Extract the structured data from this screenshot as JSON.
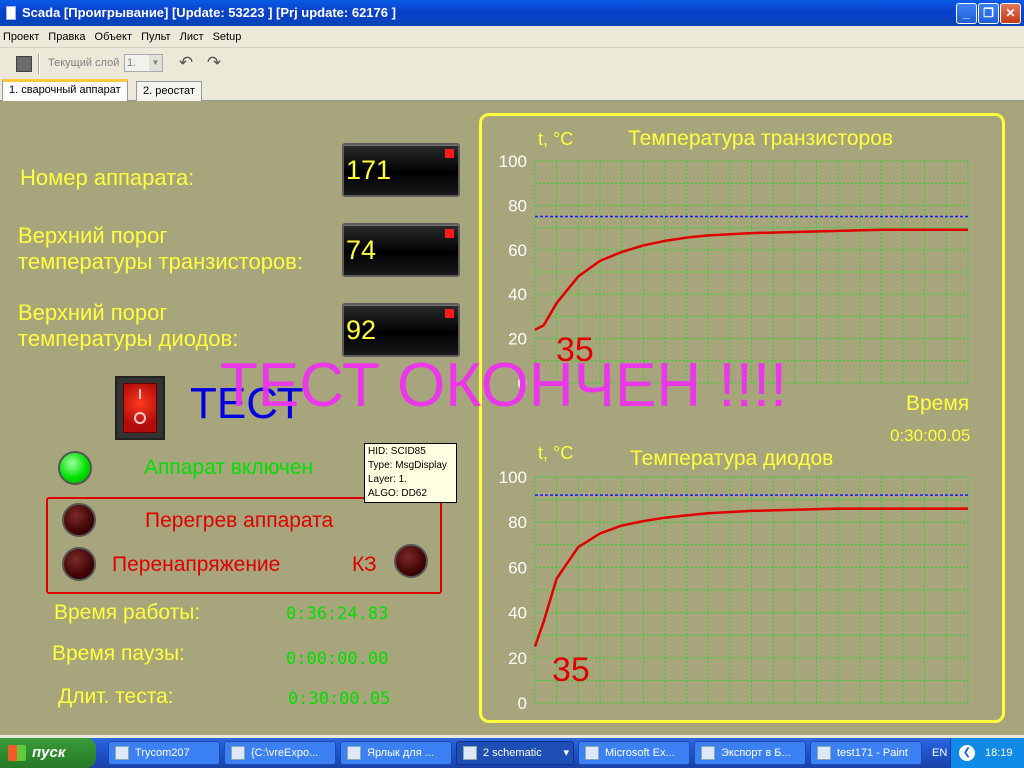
{
  "window": {
    "title": "Scada [Проигрывание] [Update: 53223 ] [Prj update: 62176 ]",
    "min_icon": "_",
    "max_icon": "❐",
    "close_icon": "✕"
  },
  "menu": [
    "Проект",
    "Правка",
    "Объект",
    "Пульт",
    "Лист",
    "Setup"
  ],
  "toolbar": {
    "layer_label": "Текущий слой",
    "layer_value": "1.",
    "undo_icon": "↶",
    "redo_icon": "↷"
  },
  "tabs": [
    "1. сварочный аппарат",
    "2. реостат"
  ],
  "panel": {
    "device_number_label": "Номер аппарата:",
    "device_number": "171",
    "transistor_threshold_label_1": "Верхний порог",
    "transistor_threshold_label_2": "температуры транзисторов:",
    "transistor_threshold": "74",
    "diode_threshold_label_1": "Верхний порог",
    "diode_threshold_label_2": "температуры диодов:",
    "diode_threshold": "92",
    "test_label": "ТЕСТ",
    "test_finished": "ТЕСТ ОКОНЧЕН !!!!",
    "device_on": "Аппарат включен",
    "overheat": "Перегрев аппарата",
    "overvoltage": "Перенапряжение",
    "short_circuit": "КЗ",
    "work_time_label": "Время работы:",
    "work_time": "0:36:24.83",
    "pause_time_label": "Время паузы:",
    "pause_time": "0:00:00.00",
    "test_duration_label": "Длит. теста:",
    "test_duration": "0:30:00.05",
    "time_label": "Время",
    "time_value": "0:30:00.05"
  },
  "tooltip": {
    "line1": "HID:  SCID85",
    "line2": "Type:  MsgDisplay",
    "line3": "Layer: 1.",
    "line4": "ALGO: DD62"
  },
  "chart_data": [
    {
      "type": "line",
      "title": "Температура транзисторов",
      "ylabel": "t, °C",
      "ylim": [
        0,
        100
      ],
      "yticks": [
        0,
        20,
        40,
        60,
        80,
        100
      ],
      "threshold": 75,
      "current_value_label": "35",
      "series": [
        {
          "x": [
            0,
            0.02,
            0.05,
            0.1,
            0.15,
            0.2,
            0.25,
            0.3,
            0.35,
            0.4,
            0.5,
            0.6,
            0.7,
            0.8,
            0.9,
            1.0
          ],
          "y": [
            24,
            26,
            36,
            48,
            55,
            59,
            62,
            64,
            65.5,
            66.5,
            67.5,
            68,
            68.5,
            69,
            69,
            69
          ]
        }
      ]
    },
    {
      "type": "line",
      "title": "Температура диодов",
      "ylabel": "t, °C",
      "ylim": [
        0,
        100
      ],
      "yticks": [
        0,
        20,
        40,
        60,
        80,
        100
      ],
      "threshold": 92,
      "current_value_label": "35",
      "series": [
        {
          "x": [
            0,
            0.02,
            0.05,
            0.1,
            0.15,
            0.2,
            0.25,
            0.3,
            0.35,
            0.4,
            0.5,
            0.6,
            0.7,
            0.8,
            0.9,
            1.0
          ],
          "y": [
            25,
            36,
            55,
            69,
            75,
            78.5,
            80.5,
            82,
            83,
            84,
            85,
            85.5,
            86,
            86,
            86,
            86
          ]
        }
      ]
    }
  ],
  "taskbar": {
    "start": "пуск",
    "tasks": [
      "Trycom207",
      "{C:\\vreExpo...",
      "Ярлык для ...",
      "2 schematic",
      "Microsoft Ex...",
      "Экспорт в Б...",
      "test171 - Paint"
    ],
    "lang": "EN",
    "clock": "18:19"
  },
  "colors": {
    "panel_bg": "#a7a57c",
    "label_yellow": "#ffff3c",
    "grid_green": "#2bd62b",
    "curve_red": "#e00000",
    "threshold_blue": "#1a1aff",
    "overlay_magenta": "#ee33ee"
  }
}
